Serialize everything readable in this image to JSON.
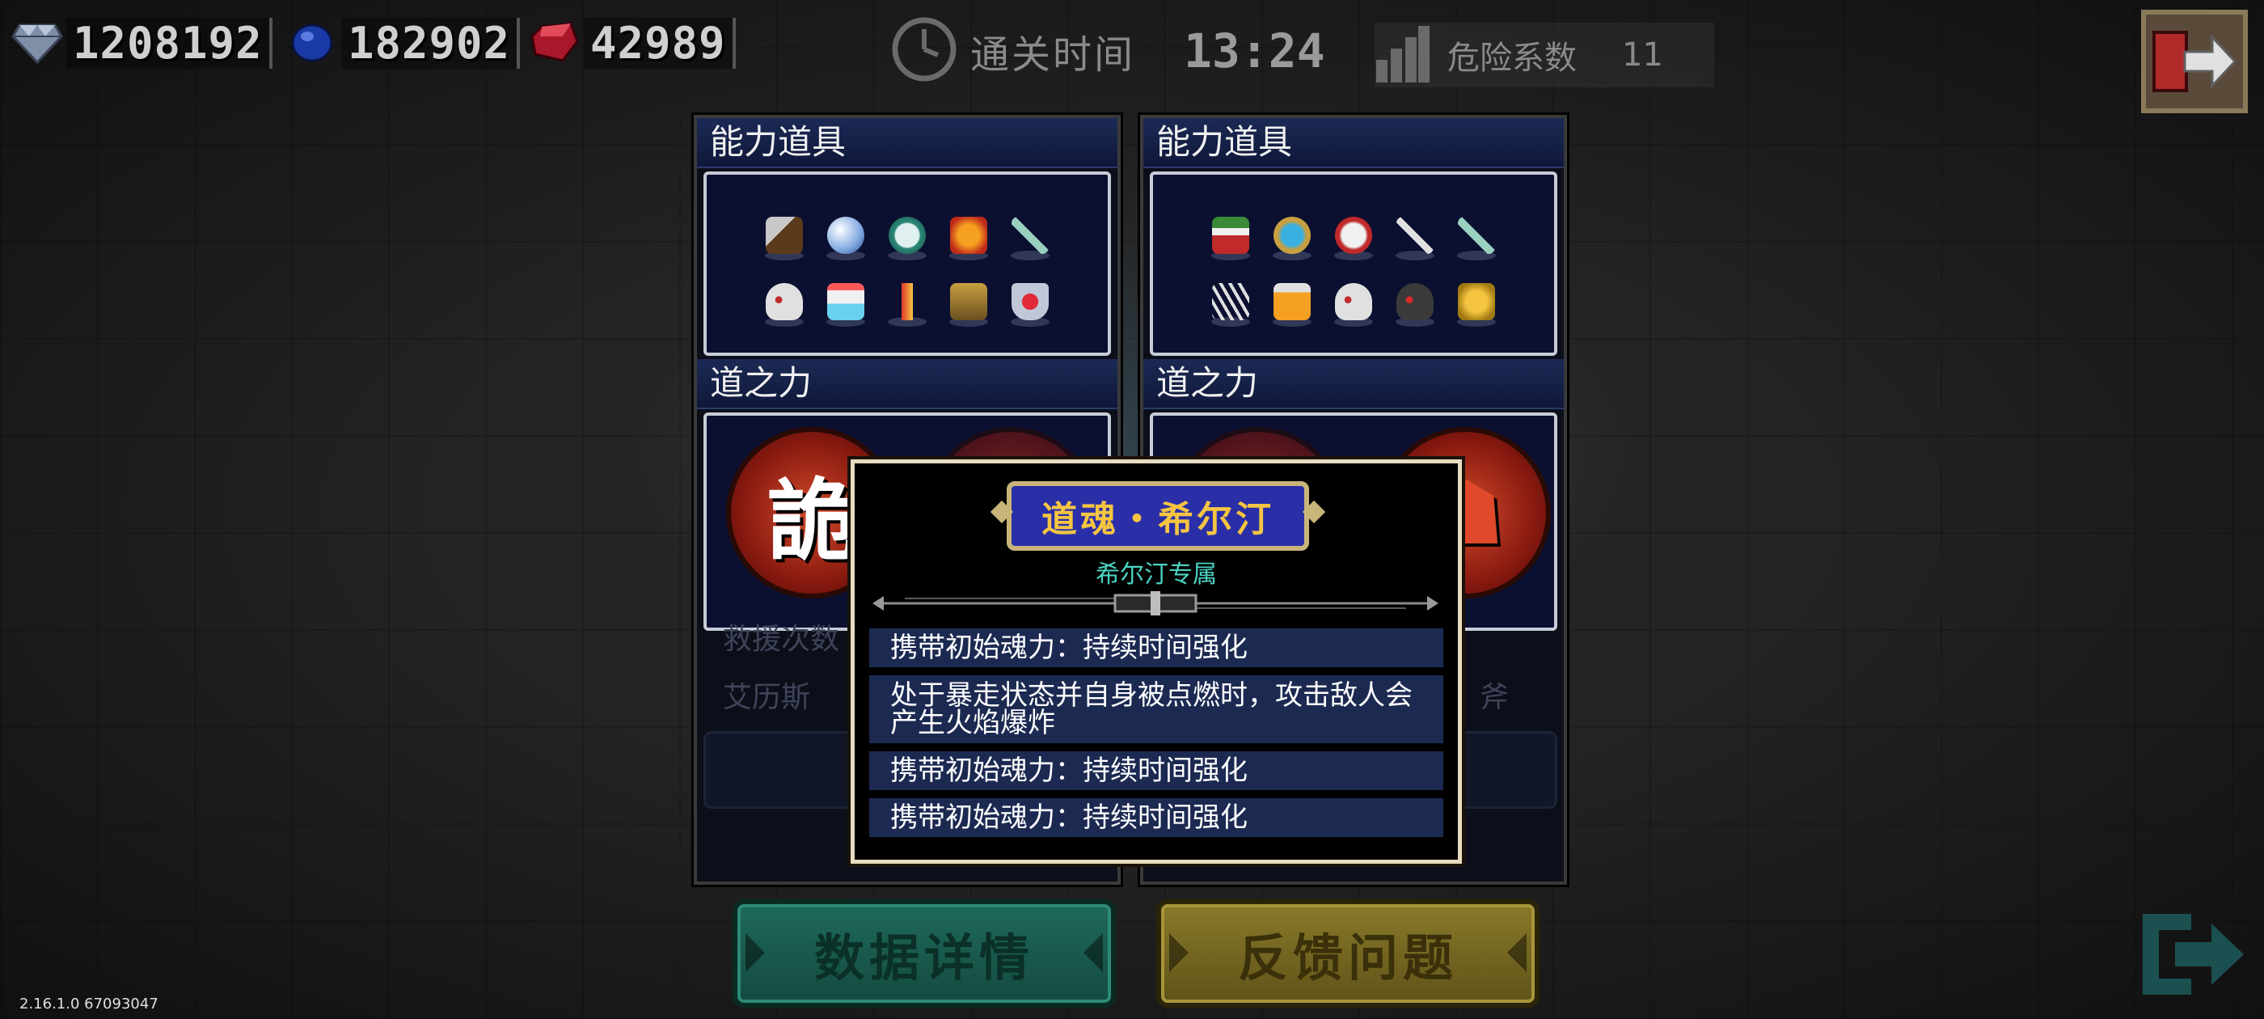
{
  "currency": {
    "gems": "1208192",
    "sapphires": "182902",
    "rubies": "42989"
  },
  "run": {
    "time_label": "通关时间",
    "time_value": "13:24",
    "danger_label": "危险系数",
    "danger_value": "11"
  },
  "panels": [
    {
      "items_title": "能力道具",
      "items": [
        "axe",
        "crystal-ball",
        "stopwatch",
        "lion-mask",
        "scythe",
        "skull",
        "sundae",
        "seahorse-staff",
        "armor",
        "heart-shield"
      ],
      "power_title": "道之力",
      "orb_glyph": "詭",
      "rescue_label": "救援次数",
      "character_label": "艾历斯"
    },
    {
      "items_title": "能力道具",
      "items": [
        "potion",
        "globe",
        "drum",
        "sword",
        "scythe",
        "claws",
        "bottle",
        "skull",
        "dark-skull",
        "golden-wings"
      ],
      "power_title": "道之力",
      "orb_glyph": "",
      "character_label": "斧"
    }
  ],
  "tooltip": {
    "title": "道魂・希尔汀",
    "subtitle": "希尔汀专属",
    "lines": [
      "携带初始魂力：持续时间强化",
      "处于暴走状态并自身被点燃时，攻击敌人会产生火焰爆炸",
      "携带初始魂力：持续时间强化",
      "携带初始魂力：持续时间强化"
    ]
  },
  "buttons": {
    "data_details": "数据详情",
    "feedback": "反馈问题"
  },
  "version": "2.16.1.0 67093047",
  "colors": {
    "tooltip_title_bg": "#2a2fa8",
    "tooltip_title_text": "#f5c542",
    "subtitle": "#4ad4c2",
    "data_button": "#1f6a5a",
    "feedback_button": "#8a7a2a"
  }
}
